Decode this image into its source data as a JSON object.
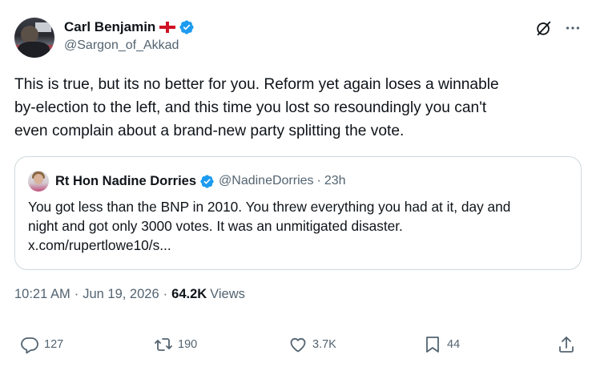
{
  "author": {
    "display_name": "Carl Benjamin",
    "handle": "@Sargon_of_Akkad"
  },
  "tweet": {
    "text_line1": "This is true, but its no better for you. Reform yet again loses a winnable",
    "text_line2": "by-election to the left, and this time you lost so resoundingly you can't",
    "text_line3": "even complain about a brand-new party splitting the vote."
  },
  "quote": {
    "display_name": "Rt Hon Nadine Dorries",
    "handle": "@NadineDorries",
    "separator": "·",
    "time": "23h",
    "text_line1": "You got less than the BNP in 2010. You threw everything you had at it, day and",
    "text_line2": "night and got only 3000 votes. It was an unmitigated disaster.",
    "text_line3": "x.com/rupertlowe10/s..."
  },
  "meta": {
    "time": "10:21 AM",
    "sep1": "·",
    "date": "Jun 19, 2026",
    "sep2": "·",
    "views_count": "64.2K",
    "views_label": "Views"
  },
  "actions": {
    "replies": "127",
    "reposts": "190",
    "likes": "3.7K",
    "bookmarks": "44"
  },
  "icons": {
    "verified": "verified-badge-icon",
    "flag": "england-flag-icon",
    "grok": "grok-icon",
    "more": "more-icon",
    "reply": "reply-icon",
    "repost": "repost-icon",
    "like": "heart-icon",
    "bookmark": "bookmark-icon",
    "share": "share-icon"
  },
  "colors": {
    "verified": "#1d9bf0",
    "secondary_text": "#536471",
    "border": "#cfd9de",
    "flag_red": "#ce1124"
  }
}
